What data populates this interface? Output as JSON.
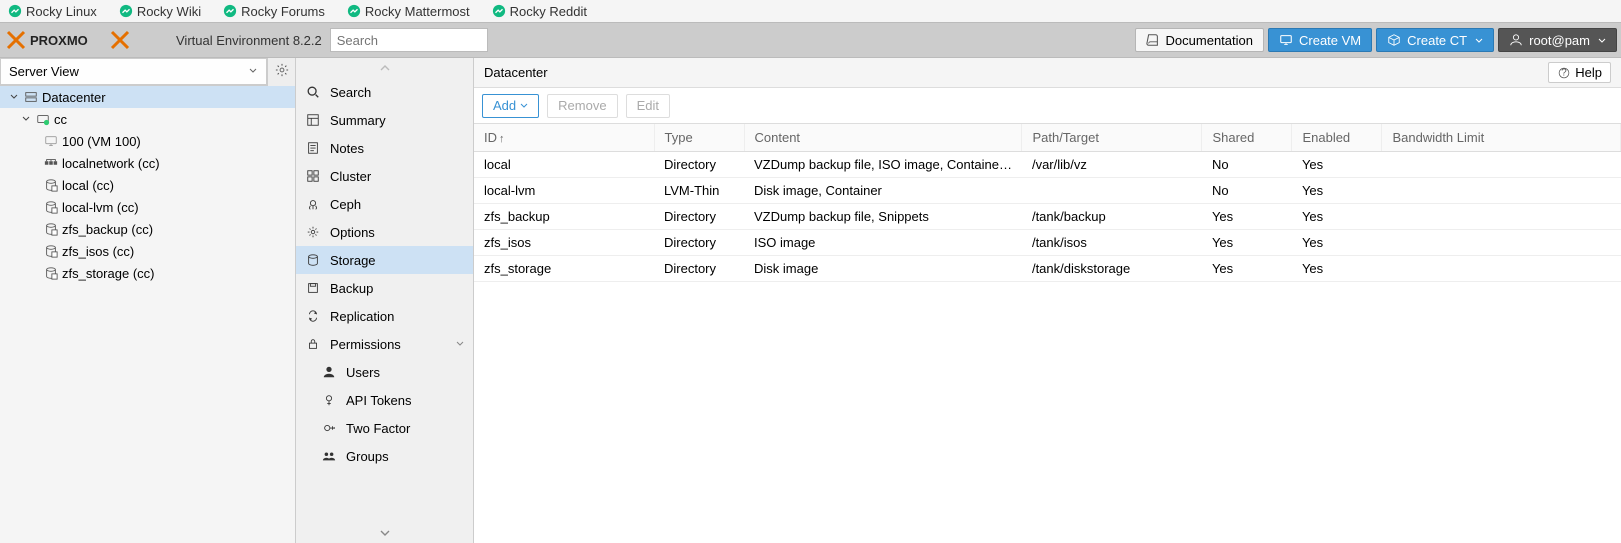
{
  "bookmarks": [
    {
      "label": "Rocky Linux"
    },
    {
      "label": "Rocky Wiki"
    },
    {
      "label": "Rocky Forums"
    },
    {
      "label": "Rocky Mattermost"
    },
    {
      "label": "Rocky Reddit"
    }
  ],
  "header": {
    "product": "PROXMOX",
    "version": "Virtual Environment 8.2.2",
    "search_placeholder": "Search",
    "doc": "Documentation",
    "create_vm": "Create VM",
    "create_ct": "Create CT",
    "user": "root@pam"
  },
  "left": {
    "view": "Server View",
    "tree": {
      "root": "Datacenter",
      "node": "cc",
      "children": [
        {
          "kind": "vm",
          "label": "100 (VM 100)"
        },
        {
          "kind": "net",
          "label": "localnetwork (cc)"
        },
        {
          "kind": "stor",
          "label": "local (cc)"
        },
        {
          "kind": "stor",
          "label": "local-lvm (cc)"
        },
        {
          "kind": "stor",
          "label": "zfs_backup (cc)"
        },
        {
          "kind": "stor",
          "label": "zfs_isos (cc)"
        },
        {
          "kind": "stor",
          "label": "zfs_storage (cc)"
        }
      ]
    }
  },
  "nav": [
    {
      "icon": "search",
      "label": "Search"
    },
    {
      "icon": "summary",
      "label": "Summary"
    },
    {
      "icon": "notes",
      "label": "Notes"
    },
    {
      "icon": "cluster",
      "label": "Cluster"
    },
    {
      "icon": "ceph",
      "label": "Ceph"
    },
    {
      "icon": "options",
      "label": "Options"
    },
    {
      "icon": "storage",
      "label": "Storage",
      "selected": true
    },
    {
      "icon": "backup",
      "label": "Backup"
    },
    {
      "icon": "replication",
      "label": "Replication"
    },
    {
      "icon": "permissions",
      "label": "Permissions",
      "expandable": true
    },
    {
      "icon": "users",
      "label": "Users",
      "sub": true
    },
    {
      "icon": "tokens",
      "label": "API Tokens",
      "sub": true
    },
    {
      "icon": "twofactor",
      "label": "Two Factor",
      "sub": true
    },
    {
      "icon": "groups",
      "label": "Groups",
      "sub": true
    }
  ],
  "crumb": "Datacenter",
  "help": "Help",
  "toolbar": {
    "add": "Add",
    "remove": "Remove",
    "edit": "Edit"
  },
  "columns": [
    "ID",
    "Type",
    "Content",
    "Path/Target",
    "Shared",
    "Enabled",
    "Bandwidth Limit"
  ],
  "rows": [
    {
      "id": "local",
      "type": "Directory",
      "content": "VZDump backup file, ISO image, Containe…",
      "path": "/var/lib/vz",
      "shared": "No",
      "enabled": "Yes",
      "bw": ""
    },
    {
      "id": "local-lvm",
      "type": "LVM-Thin",
      "content": "Disk image, Container",
      "path": "",
      "shared": "No",
      "enabled": "Yes",
      "bw": ""
    },
    {
      "id": "zfs_backup",
      "type": "Directory",
      "content": "VZDump backup file, Snippets",
      "path": "/tank/backup",
      "shared": "Yes",
      "enabled": "Yes",
      "bw": ""
    },
    {
      "id": "zfs_isos",
      "type": "Directory",
      "content": "ISO image",
      "path": "/tank/isos",
      "shared": "Yes",
      "enabled": "Yes",
      "bw": ""
    },
    {
      "id": "zfs_storage",
      "type": "Directory",
      "content": "Disk image",
      "path": "/tank/diskstorage",
      "shared": "Yes",
      "enabled": "Yes",
      "bw": ""
    }
  ]
}
